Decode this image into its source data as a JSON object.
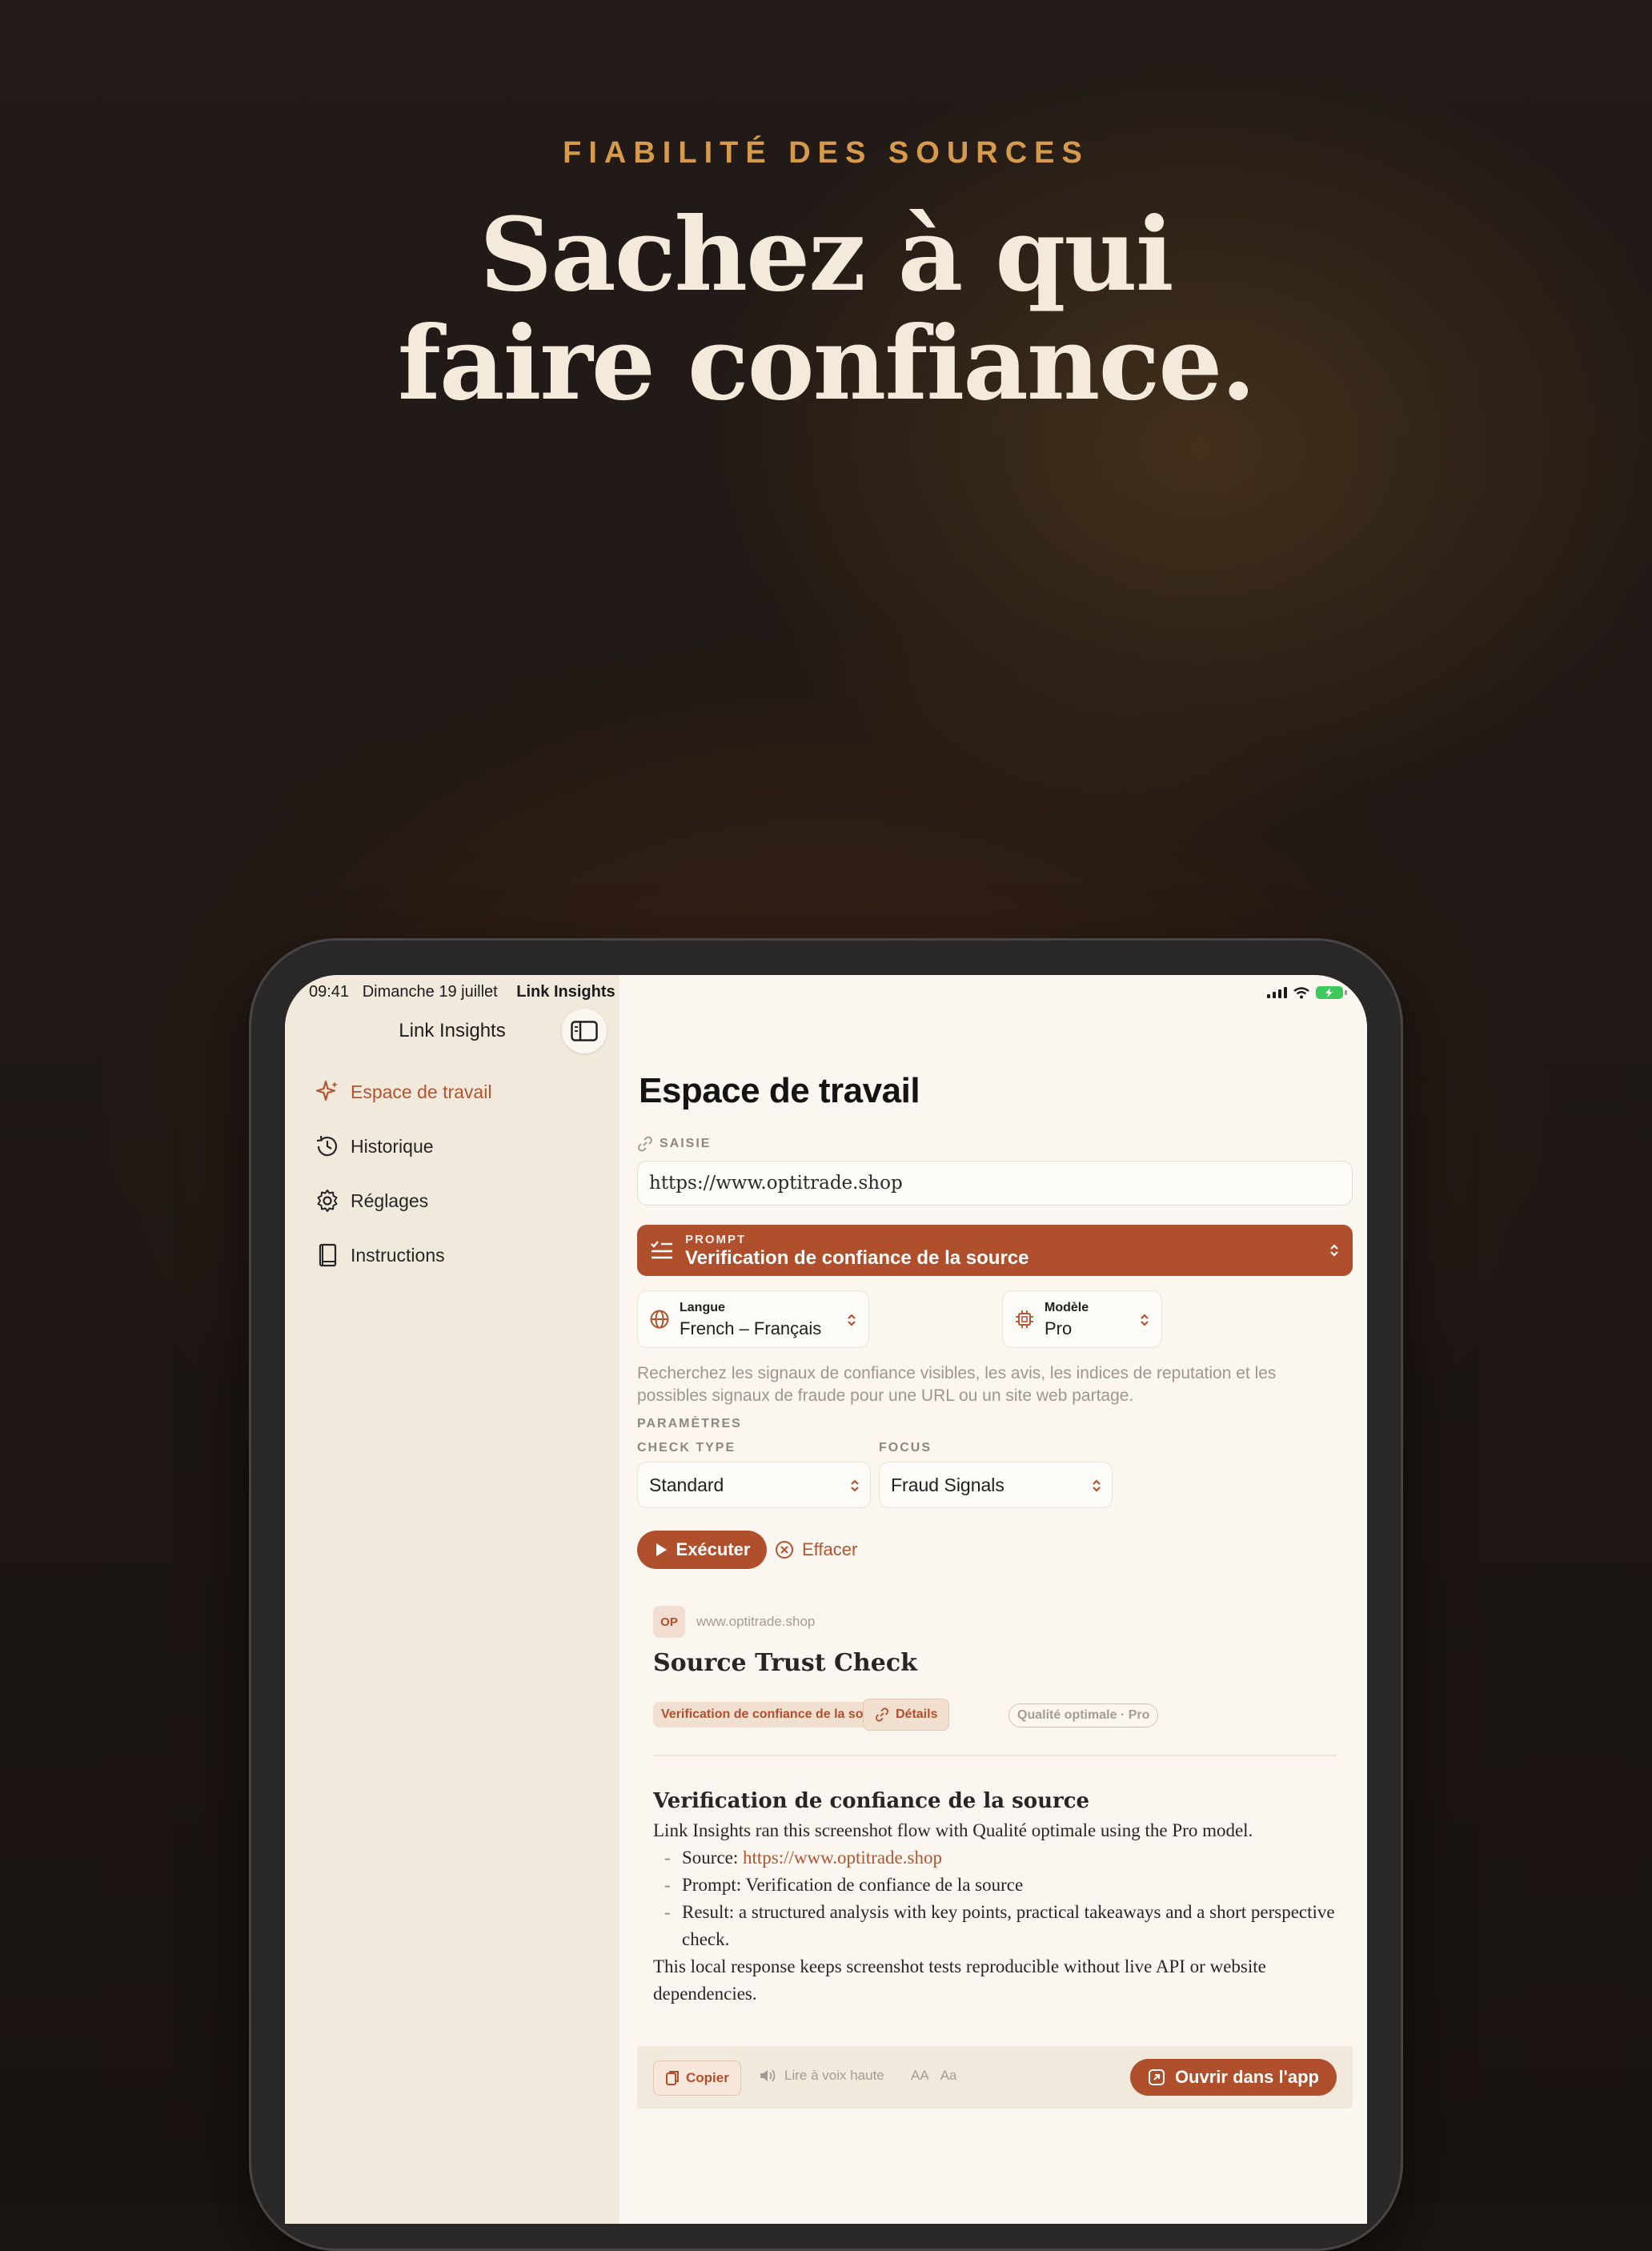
{
  "hero": {
    "eyebrow": "FIABILITÉ DES SOURCES",
    "headline_line1": "Sachez à qui",
    "headline_line2": "faire confiance."
  },
  "status_bar": {
    "time": "09:41",
    "date": "Dimanche 19 juillet",
    "app": "Link Insights"
  },
  "sidebar": {
    "title": "Link Insights",
    "items": [
      {
        "label": "Espace de travail",
        "icon": "sparkle-icon",
        "active": true
      },
      {
        "label": "Historique",
        "icon": "history-icon"
      },
      {
        "label": "Réglages",
        "icon": "gear-icon"
      },
      {
        "label": "Instructions",
        "icon": "book-icon"
      }
    ]
  },
  "workspace": {
    "title": "Espace de travail",
    "input_label": "SAISIE",
    "url_value": "https://www.optitrade.shop",
    "prompt_label": "PROMPT",
    "prompt_value": "Verification de confiance de la source",
    "language_label": "Langue",
    "language_value": "French – Français",
    "model_label": "Modèle",
    "model_value": "Pro",
    "description": "Recherchez les signaux de confiance visibles, les avis, les indices de reputation et les possibles signaux de fraude pour une URL ou un site web partage.",
    "params_label": "PARAMÈTRES",
    "check_type_label": "CHECK TYPE",
    "check_type_value": "Standard",
    "focus_label": "FOCUS",
    "focus_value": "Fraud Signals",
    "run_label": "Exécuter",
    "clear_label": "Effacer"
  },
  "result": {
    "badge": "OP",
    "domain": "www.optitrade.shop",
    "title": "Source Trust Check",
    "chips": {
      "prompt": "Verification de confiance de la source",
      "details": "Détails",
      "quality": "Qualité optimale · Pro"
    },
    "heading": "Verification de confiance de la source",
    "intro": "Link Insights ran this screenshot flow with Qualité optimale using the Pro model.",
    "source_prefix": "Source: ",
    "source_link": "https://www.optitrade.shop",
    "prompt_line": "Prompt: Verification de confiance de la source",
    "result_line": "Result: a structured analysis with key points, practical takeaways and a short perspective check.",
    "outro": "This local response keeps screenshot tests reproducible without live API or website dependencies."
  },
  "footer": {
    "copy": "Copier",
    "read_aloud": "Lire à voix haute",
    "text_size_small": "AA",
    "text_size_alt": "Aa",
    "open_app": "Ouvrir dans l'app"
  },
  "colors": {
    "accent": "#b04f2c",
    "eyebrow": "#d59a4c",
    "headline": "#f4eadb",
    "sidebar_bg": "#f2e9dd",
    "content_bg": "#fbf7f0",
    "battery": "#3ec95c"
  }
}
